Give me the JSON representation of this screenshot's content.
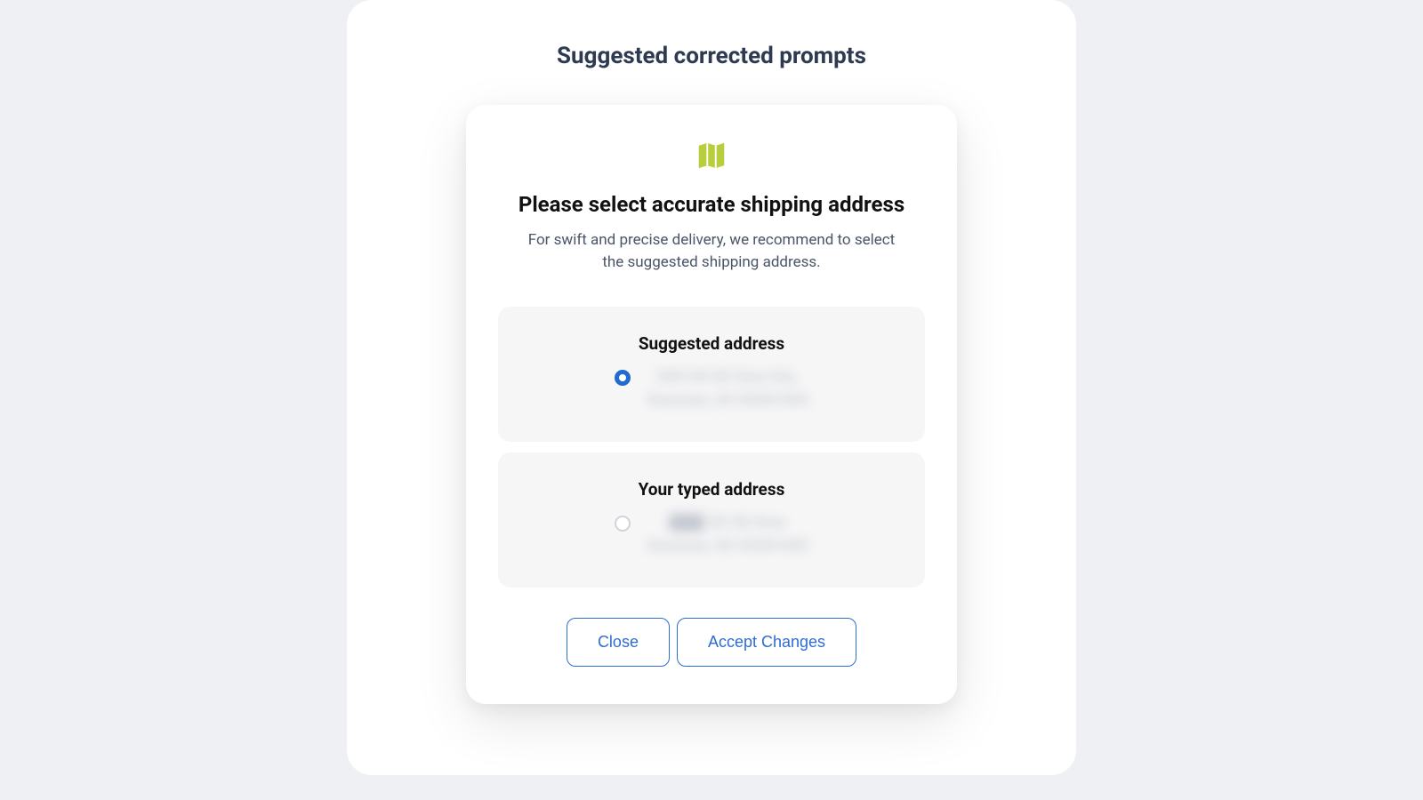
{
  "page": {
    "heading": "Suggested corrected prompts"
  },
  "modal": {
    "title": "Please select accurate shipping address",
    "description": "For swift and precise delivery, we recommend to select the suggested shipping address.",
    "options": {
      "suggested": {
        "label": "Suggested address",
        "selected": true,
        "line1": "XXX XX XX Xxxx Xxx,",
        "line2": "Xxxxxxxx, XX XXXX-XXX"
      },
      "typed": {
        "label": "Your typed address",
        "selected": false,
        "line1_prefix": "XXX",
        "line1_rest": " XX XX Xxxx",
        "line2": "Xxxxxxxx, XX XXXX-XXX"
      }
    },
    "buttons": {
      "close": "Close",
      "accept": "Accept Changes"
    }
  },
  "colors": {
    "accent": "#2e6dd1",
    "icon": "#b9ce3c"
  }
}
